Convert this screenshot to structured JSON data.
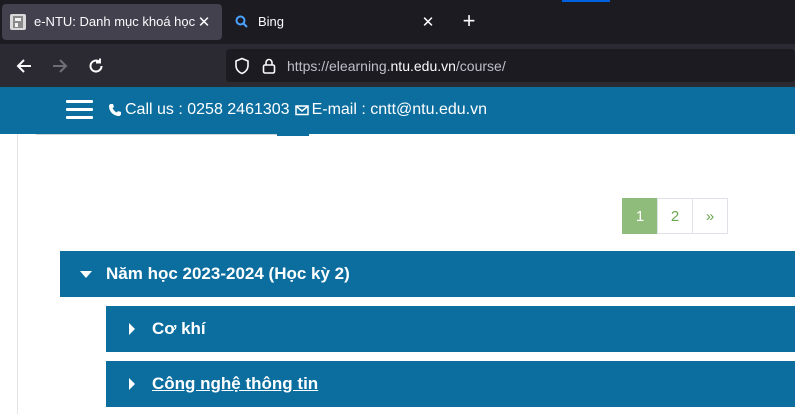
{
  "browser": {
    "tabs": [
      {
        "title": "e-NTU: Danh mục khoá học",
        "active": true,
        "icon": "ntu-favicon"
      },
      {
        "title": "Bing",
        "active": false,
        "icon": "search-icon"
      }
    ],
    "url_prefix": "https://elearning.",
    "url_host": "ntu.edu.vn",
    "url_path": "/course/"
  },
  "header": {
    "call_label": "Call us : 0258 2461303",
    "email_label": "E-mail : cntt@ntu.edu.vn"
  },
  "pagination": {
    "pages": [
      "1",
      "2"
    ],
    "next_label": "»",
    "current": "1"
  },
  "categories": {
    "parent": {
      "label": "Năm học 2023-2024 (Học kỳ 2)",
      "expanded": true
    },
    "children": [
      {
        "label": "Cơ khí",
        "expanded": false
      },
      {
        "label": "Công nghệ thông tin",
        "expanded": false
      }
    ]
  },
  "colors": {
    "brand_blue": "#0c6e9f",
    "pagination_active": "#8fbc7b",
    "chrome_dark": "#1c1b22"
  }
}
